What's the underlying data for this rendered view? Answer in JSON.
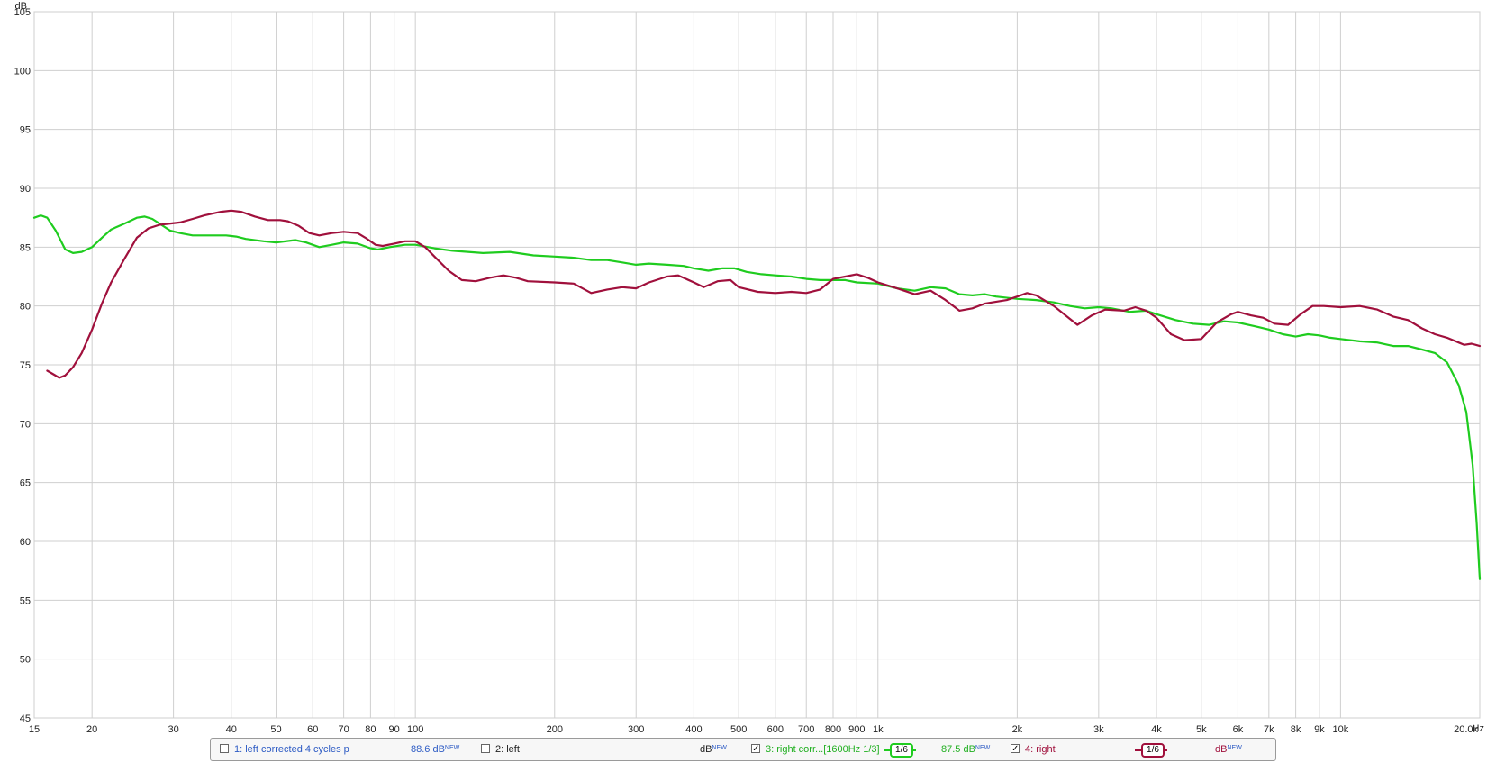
{
  "chart_data": {
    "type": "line",
    "xscale": "log",
    "xlim": [
      15,
      20000
    ],
    "ylim": [
      45,
      105
    ],
    "ylabel": "dB",
    "xunit": "Hz",
    "grid": true,
    "yticks": [
      45,
      50,
      55,
      60,
      65,
      70,
      75,
      80,
      85,
      90,
      95,
      100,
      105
    ],
    "xticks": [
      {
        "v": 15,
        "label": "15"
      },
      {
        "v": 20,
        "label": "20"
      },
      {
        "v": 30,
        "label": "30"
      },
      {
        "v": 40,
        "label": "40"
      },
      {
        "v": 50,
        "label": "50"
      },
      {
        "v": 60,
        "label": "60"
      },
      {
        "v": 70,
        "label": "70"
      },
      {
        "v": 80,
        "label": "80"
      },
      {
        "v": 90,
        "label": "90"
      },
      {
        "v": 100,
        "label": "100"
      },
      {
        "v": 200,
        "label": "200"
      },
      {
        "v": 300,
        "label": "300"
      },
      {
        "v": 400,
        "label": "400"
      },
      {
        "v": 500,
        "label": "500"
      },
      {
        "v": 600,
        "label": "600"
      },
      {
        "v": 700,
        "label": "700"
      },
      {
        "v": 800,
        "label": "800"
      },
      {
        "v": 900,
        "label": "900"
      },
      {
        "v": 1000,
        "label": "1k"
      },
      {
        "v": 2000,
        "label": "2k"
      },
      {
        "v": 3000,
        "label": "3k"
      },
      {
        "v": 4000,
        "label": "4k"
      },
      {
        "v": 5000,
        "label": "5k"
      },
      {
        "v": 6000,
        "label": "6k"
      },
      {
        "v": 7000,
        "label": "7k"
      },
      {
        "v": 8000,
        "label": "8k"
      },
      {
        "v": 9000,
        "label": "9k"
      },
      {
        "v": 10000,
        "label": "10k"
      },
      {
        "v": 20000,
        "label": "20.0k"
      }
    ],
    "series": [
      {
        "name": "3: right corr...[1600Hz 1/3]",
        "color": "#1fcc1f",
        "points": [
          [
            15,
            87.5
          ],
          [
            15.5,
            87.7
          ],
          [
            16,
            87.5
          ],
          [
            16.7,
            86.4
          ],
          [
            17.5,
            84.8
          ],
          [
            18.2,
            84.5
          ],
          [
            19,
            84.6
          ],
          [
            20,
            85.0
          ],
          [
            21,
            85.8
          ],
          [
            22,
            86.5
          ],
          [
            23.5,
            87.0
          ],
          [
            25,
            87.5
          ],
          [
            26,
            87.6
          ],
          [
            27,
            87.4
          ],
          [
            28,
            87.0
          ],
          [
            29.5,
            86.4
          ],
          [
            31,
            86.2
          ],
          [
            33,
            86.0
          ],
          [
            36,
            86.0
          ],
          [
            39,
            86.0
          ],
          [
            41,
            85.9
          ],
          [
            43,
            85.7
          ],
          [
            47,
            85.5
          ],
          [
            50,
            85.4
          ],
          [
            55,
            85.6
          ],
          [
            58,
            85.4
          ],
          [
            62,
            85.0
          ],
          [
            66,
            85.2
          ],
          [
            70,
            85.4
          ],
          [
            75,
            85.3
          ],
          [
            80,
            84.9
          ],
          [
            83,
            84.8
          ],
          [
            88,
            85.0
          ],
          [
            95,
            85.2
          ],
          [
            100,
            85.2
          ],
          [
            110,
            84.9
          ],
          [
            120,
            84.7
          ],
          [
            140,
            84.5
          ],
          [
            160,
            84.6
          ],
          [
            180,
            84.3
          ],
          [
            200,
            84.2
          ],
          [
            220,
            84.1
          ],
          [
            240,
            83.9
          ],
          [
            260,
            83.9
          ],
          [
            280,
            83.7
          ],
          [
            300,
            83.5
          ],
          [
            320,
            83.6
          ],
          [
            350,
            83.5
          ],
          [
            380,
            83.4
          ],
          [
            400,
            83.2
          ],
          [
            430,
            83.0
          ],
          [
            460,
            83.2
          ],
          [
            490,
            83.2
          ],
          [
            520,
            82.9
          ],
          [
            560,
            82.7
          ],
          [
            600,
            82.6
          ],
          [
            650,
            82.5
          ],
          [
            700,
            82.3
          ],
          [
            750,
            82.2
          ],
          [
            800,
            82.2
          ],
          [
            850,
            82.2
          ],
          [
            900,
            82.0
          ],
          [
            1000,
            81.9
          ],
          [
            1100,
            81.5
          ],
          [
            1200,
            81.3
          ],
          [
            1300,
            81.6
          ],
          [
            1400,
            81.5
          ],
          [
            1500,
            81.0
          ],
          [
            1600,
            80.9
          ],
          [
            1700,
            81.0
          ],
          [
            1800,
            80.8
          ],
          [
            2000,
            80.6
          ],
          [
            2200,
            80.5
          ],
          [
            2400,
            80.3
          ],
          [
            2600,
            80.0
          ],
          [
            2800,
            79.8
          ],
          [
            3000,
            79.9
          ],
          [
            3200,
            79.8
          ],
          [
            3500,
            79.5
          ],
          [
            3800,
            79.6
          ],
          [
            4000,
            79.3
          ],
          [
            4400,
            78.8
          ],
          [
            4800,
            78.5
          ],
          [
            5200,
            78.4
          ],
          [
            5600,
            78.7
          ],
          [
            6000,
            78.6
          ],
          [
            6500,
            78.3
          ],
          [
            7000,
            78.0
          ],
          [
            7500,
            77.6
          ],
          [
            8000,
            77.4
          ],
          [
            8500,
            77.6
          ],
          [
            9000,
            77.5
          ],
          [
            9500,
            77.3
          ],
          [
            10000,
            77.2
          ],
          [
            11000,
            77.0
          ],
          [
            12000,
            76.9
          ],
          [
            13000,
            76.6
          ],
          [
            14000,
            76.6
          ],
          [
            15000,
            76.3
          ],
          [
            16000,
            76.0
          ],
          [
            17000,
            75.2
          ],
          [
            18000,
            73.3
          ],
          [
            18700,
            71.0
          ],
          [
            19300,
            66.5
          ],
          [
            19700,
            61.5
          ],
          [
            20000,
            56.8
          ]
        ]
      },
      {
        "name": "4: right",
        "color": "#a0103c",
        "points": [
          [
            16,
            74.5
          ],
          [
            16.5,
            74.2
          ],
          [
            17,
            73.9
          ],
          [
            17.5,
            74.1
          ],
          [
            18.2,
            74.8
          ],
          [
            19,
            76.0
          ],
          [
            20,
            78.0
          ],
          [
            21,
            80.2
          ],
          [
            22,
            82.0
          ],
          [
            23.5,
            84.0
          ],
          [
            25,
            85.8
          ],
          [
            26.5,
            86.6
          ],
          [
            28,
            86.9
          ],
          [
            31,
            87.1
          ],
          [
            33,
            87.4
          ],
          [
            35,
            87.7
          ],
          [
            38,
            88.0
          ],
          [
            40,
            88.1
          ],
          [
            42,
            88.0
          ],
          [
            45,
            87.6
          ],
          [
            48,
            87.3
          ],
          [
            51,
            87.3
          ],
          [
            53,
            87.2
          ],
          [
            56,
            86.8
          ],
          [
            59,
            86.2
          ],
          [
            62,
            86.0
          ],
          [
            66,
            86.2
          ],
          [
            70,
            86.3
          ],
          [
            75,
            86.2
          ],
          [
            78,
            85.8
          ],
          [
            82,
            85.2
          ],
          [
            85,
            85.1
          ],
          [
            90,
            85.3
          ],
          [
            95,
            85.5
          ],
          [
            100,
            85.5
          ],
          [
            105,
            85.0
          ],
          [
            110,
            84.2
          ],
          [
            118,
            83.0
          ],
          [
            126,
            82.2
          ],
          [
            135,
            82.1
          ],
          [
            145,
            82.4
          ],
          [
            155,
            82.6
          ],
          [
            165,
            82.4
          ],
          [
            175,
            82.1
          ],
          [
            200,
            82.0
          ],
          [
            220,
            81.9
          ],
          [
            240,
            81.1
          ],
          [
            260,
            81.4
          ],
          [
            280,
            81.6
          ],
          [
            300,
            81.5
          ],
          [
            320,
            82.0
          ],
          [
            350,
            82.5
          ],
          [
            370,
            82.6
          ],
          [
            400,
            82.0
          ],
          [
            420,
            81.6
          ],
          [
            450,
            82.1
          ],
          [
            480,
            82.2
          ],
          [
            500,
            81.6
          ],
          [
            550,
            81.2
          ],
          [
            600,
            81.1
          ],
          [
            650,
            81.2
          ],
          [
            700,
            81.1
          ],
          [
            750,
            81.4
          ],
          [
            800,
            82.3
          ],
          [
            850,
            82.5
          ],
          [
            900,
            82.7
          ],
          [
            950,
            82.4
          ],
          [
            1000,
            82.0
          ],
          [
            1100,
            81.5
          ],
          [
            1200,
            81.0
          ],
          [
            1300,
            81.3
          ],
          [
            1400,
            80.5
          ],
          [
            1500,
            79.6
          ],
          [
            1600,
            79.8
          ],
          [
            1700,
            80.2
          ],
          [
            1900,
            80.5
          ],
          [
            2000,
            80.8
          ],
          [
            2100,
            81.1
          ],
          [
            2200,
            80.9
          ],
          [
            2400,
            80.0
          ],
          [
            2600,
            78.9
          ],
          [
            2700,
            78.4
          ],
          [
            2900,
            79.2
          ],
          [
            3100,
            79.7
          ],
          [
            3400,
            79.6
          ],
          [
            3600,
            79.9
          ],
          [
            3800,
            79.6
          ],
          [
            4000,
            79.0
          ],
          [
            4300,
            77.6
          ],
          [
            4600,
            77.1
          ],
          [
            5000,
            77.2
          ],
          [
            5400,
            78.6
          ],
          [
            5800,
            79.3
          ],
          [
            6000,
            79.5
          ],
          [
            6400,
            79.2
          ],
          [
            6800,
            79.0
          ],
          [
            7200,
            78.5
          ],
          [
            7700,
            78.4
          ],
          [
            8200,
            79.3
          ],
          [
            8700,
            80.0
          ],
          [
            9200,
            80.0
          ],
          [
            10000,
            79.9
          ],
          [
            11000,
            80.0
          ],
          [
            12000,
            79.7
          ],
          [
            13000,
            79.1
          ],
          [
            14000,
            78.8
          ],
          [
            15000,
            78.1
          ],
          [
            16000,
            77.6
          ],
          [
            17000,
            77.3
          ],
          [
            18000,
            76.9
          ],
          [
            18500,
            76.7
          ],
          [
            19200,
            76.8
          ],
          [
            20000,
            76.6
          ]
        ]
      }
    ]
  },
  "legend": {
    "items": [
      {
        "label": "1: left corrected 4 cycles p",
        "checked": false,
        "value": "88.6 dB",
        "new": "NEW"
      },
      {
        "label": "2: left",
        "checked": false,
        "value": "dB",
        "new": "NEW"
      },
      {
        "label": "3: right corr...[1600Hz 1/3]",
        "checked": true,
        "smoothing": "1/6",
        "value": "87.5 dB",
        "new": "NEW"
      },
      {
        "label": "4: right",
        "checked": true,
        "smoothing": "1/6",
        "value": "dB",
        "new": "NEW"
      }
    ],
    "check_mark": "✓"
  }
}
